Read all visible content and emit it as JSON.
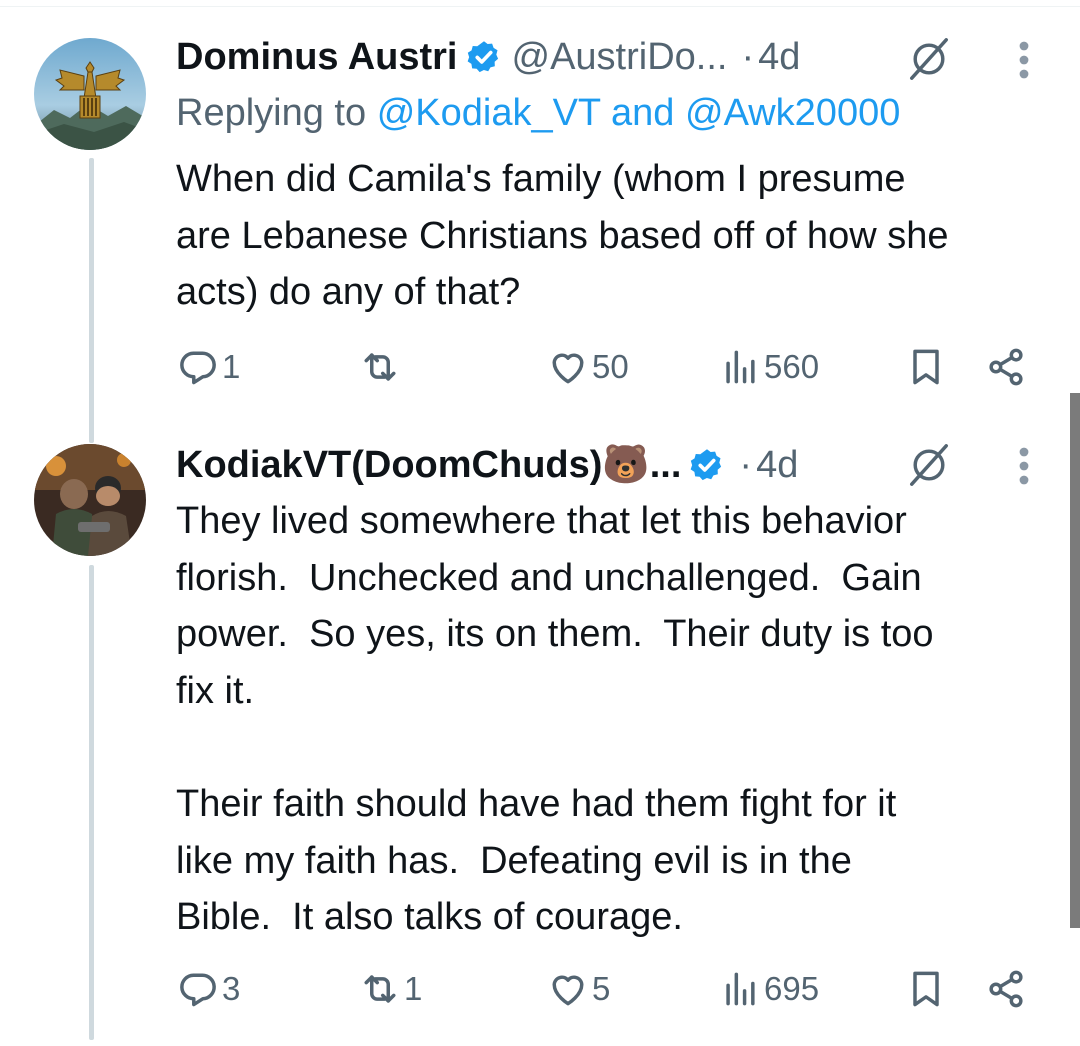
{
  "tweets": [
    {
      "display_name": "Dominus Austri",
      "handle": "@AustriDo...",
      "time": "4d",
      "reply_prefix": "Replying to",
      "reply_mention_1": "@Kodiak_VT",
      "reply_conj": "and",
      "reply_mention_2": "@Awk20000",
      "text": "When did Camila's family (whom I presume\nare Lebanese Christians based off of how she\nacts) do any of that?",
      "replies": "1",
      "reposts": "",
      "likes": "50",
      "views": "560"
    },
    {
      "display_name": "KodiakVT(DoomChuds)🐻...",
      "time": "4d",
      "text": "They lived somewhere that let this behavior\nflorish.  Unchecked and unchallenged.  Gain\npower.  So yes, its on them.  Their duty is too\nfix it.\n\nTheir faith should have had them fight for it\nlike my faith has.  Defeating evil is in the\nBible.  It also talks of courage.",
      "replies": "3",
      "reposts": "1",
      "likes": "5",
      "views": "695"
    }
  ],
  "dot_separator": "·",
  "colors": {
    "text": "#0f1419",
    "secondary": "#536471",
    "link": "#1d9bf0",
    "verified": "#1d9bf0",
    "thread_line": "#cfd9de"
  }
}
